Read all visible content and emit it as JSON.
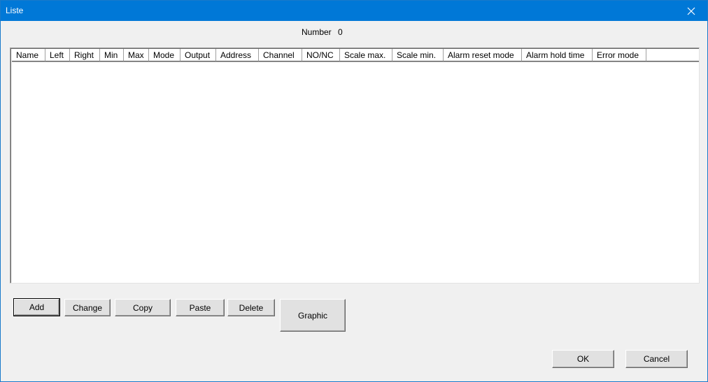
{
  "window": {
    "title": "Liste",
    "close_icon": "close-icon"
  },
  "summary": {
    "label": "Number",
    "value": "0"
  },
  "table": {
    "columns": [
      "Name",
      "Left",
      "Right",
      "Min",
      "Max",
      "Mode",
      "Output",
      "Address",
      "Channel",
      "NO/NC",
      "Scale max.",
      "Scale min.",
      "Alarm reset mode",
      "Alarm hold time",
      "Error mode"
    ],
    "rows": []
  },
  "buttons": {
    "add": "Add",
    "change": "Change",
    "copy": "Copy",
    "paste": "Paste",
    "delete": "Delete",
    "graphic": "Graphic",
    "ok": "OK",
    "cancel": "Cancel"
  },
  "colors": {
    "titlebar": "#0078d7",
    "dialog_bg": "#f0f0f0"
  }
}
